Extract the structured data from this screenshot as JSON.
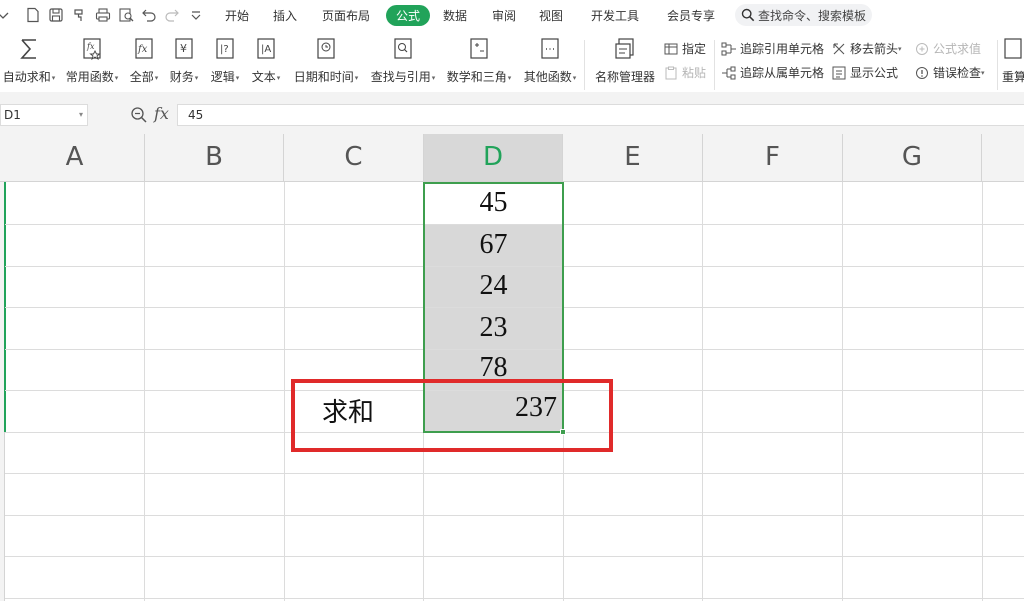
{
  "quick_access": [
    "collapse-chevron-icon",
    "new-file-icon",
    "save-icon",
    "format-painter-icon",
    "print-icon",
    "print-preview-icon",
    "undo-icon",
    "redo-icon",
    "more-dropdown-icon"
  ],
  "menu_tabs": [
    "开始",
    "插入",
    "页面布局",
    "公式",
    "数据",
    "审阅",
    "视图",
    "开发工具",
    "会员专享"
  ],
  "active_tab": "公式",
  "search": {
    "placeholder": "查找命令、搜索模板"
  },
  "ribbon": {
    "autosum": "自动求和",
    "common_functions": "常用函数",
    "all": "全部",
    "finance": "财务",
    "logic": "逻辑",
    "text": "文本",
    "datetime": "日期和时间",
    "lookup": "查找与引用",
    "math": "数学和三角",
    "other_functions": "其他函数",
    "name_manager": "名称管理器",
    "assign": "指定",
    "paste": "粘贴",
    "trace_precedents": "追踪引用单元格",
    "trace_dependents": "追踪从属单元格",
    "remove_arrows": "移去箭头",
    "show_formulas": "显示公式",
    "evaluate_formula": "公式求值",
    "error_check": "错误检查",
    "recalc": "重算"
  },
  "formula_bar": {
    "name_box": "D1",
    "fx": "fx",
    "value": "45"
  },
  "columns": [
    "A",
    "B",
    "C",
    "D",
    "E",
    "F",
    "G"
  ],
  "selected_column": "D",
  "cells": {
    "D_values": [
      "45",
      "67",
      "24",
      "23",
      "78"
    ],
    "sum_label": "求和",
    "sum_value": "237"
  },
  "colors": {
    "accent_green": "#21a35a",
    "highlight_red": "#e02a2a",
    "selection_gray": "#d8d8d8"
  }
}
